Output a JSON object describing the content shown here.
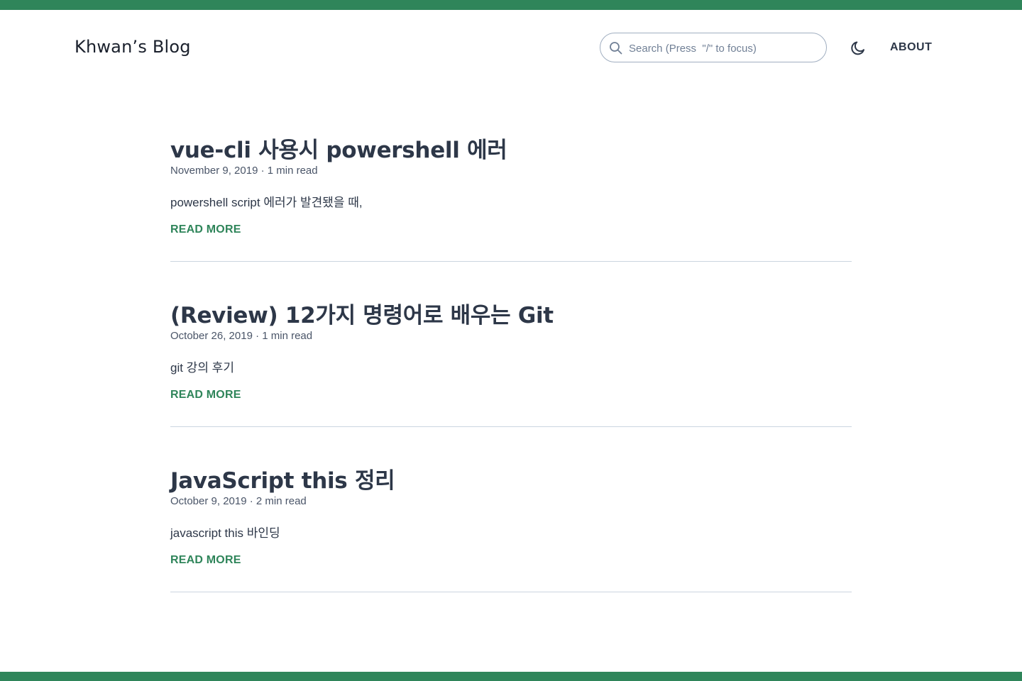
{
  "site": {
    "title": "Khwan’s Blog",
    "accent_color": "#2f855a"
  },
  "header": {
    "search": {
      "placeholder": "Search (Press  \"/\" to focus)",
      "value": "",
      "icon": "search-icon"
    },
    "theme_toggle_icon": "moon-icon",
    "nav": {
      "about_label": "ABOUT"
    }
  },
  "posts": [
    {
      "title": "vue-cli 사용시 powershell 에러",
      "meta": "November 9, 2019 · 1 min read",
      "excerpt": "powershell script 에러가 발견됐을 때,",
      "read_more": "READ MORE"
    },
    {
      "title": "(Review) 12가지 명령어로 배우는 Git",
      "meta": "October 26, 2019 · 1 min read",
      "excerpt": "git 강의 후기",
      "read_more": "READ MORE"
    },
    {
      "title": "JavaScript this 정리",
      "meta": "October 9, 2019 · 2 min read",
      "excerpt": "javascript this 바인딩",
      "read_more": "READ MORE"
    }
  ]
}
